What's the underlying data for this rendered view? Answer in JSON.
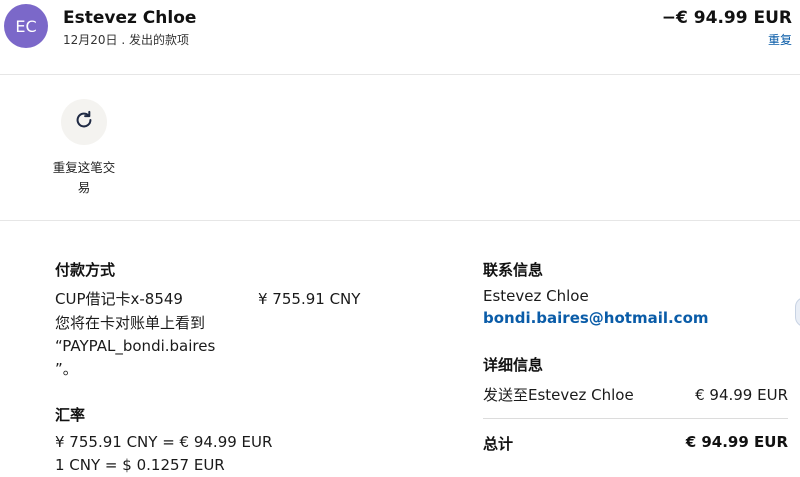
{
  "header": {
    "avatar_initials": "EC",
    "name": "Estevez Chloe",
    "subtitle": "12月20日 . 发出的款项",
    "amount": "−€ 94.99 EUR",
    "repeat_link": "重复"
  },
  "action": {
    "repeat_label": "重复这笔交易"
  },
  "payment": {
    "heading": "付款方式",
    "card": "CUP借记卡x-8549",
    "card_amount": "¥ 755.91 CNY",
    "statement_note_1": "您将在卡对账单上看到",
    "statement_note_2": "“PAYPAL_bondi.baires",
    "statement_note_3": "”。"
  },
  "exchange": {
    "heading": "汇率",
    "line1": "¥ 755.91 CNY = € 94.99 EUR",
    "line2": "1 CNY = $ 0.1257 EUR"
  },
  "contact": {
    "heading": "联系信息",
    "name": "Estevez Chloe",
    "email": "bondi.baires@hotmail.com"
  },
  "details": {
    "heading": "详细信息",
    "sent_to_label": "发送至Estevez Chloe",
    "sent_to_amount": "€ 94.99 EUR",
    "total_label": "总计",
    "total_amount": "€ 94.99 EUR"
  },
  "colors": {
    "avatar": "#7b68c9",
    "link": "#0a5ca8"
  }
}
